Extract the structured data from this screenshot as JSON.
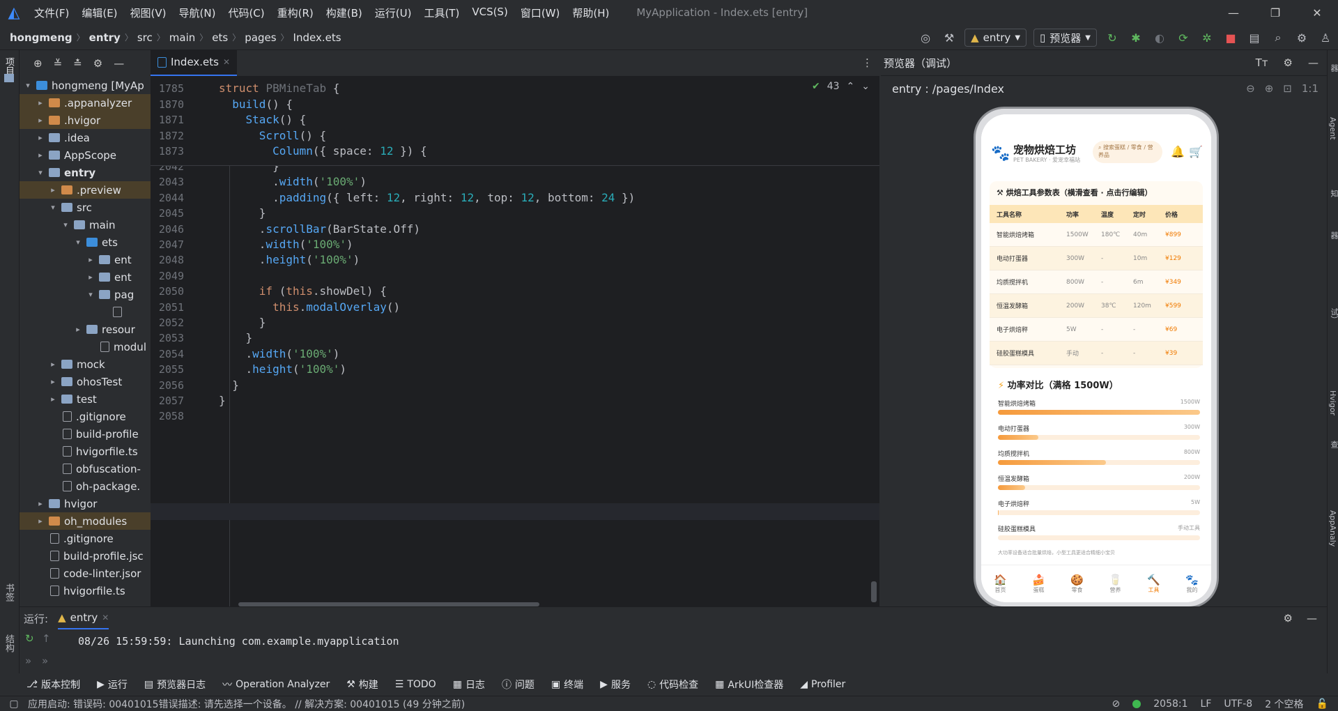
{
  "titlebar": {
    "menus": [
      "文件(F)",
      "编辑(E)",
      "视图(V)",
      "导航(N)",
      "代码(C)",
      "重构(R)",
      "构建(B)",
      "运行(U)",
      "工具(T)",
      "VCS(S)",
      "窗口(W)",
      "帮助(H)"
    ],
    "title": "MyApplication - Index.ets [entry]"
  },
  "breadcrumb": [
    "hongmeng",
    "entry",
    "src",
    "main",
    "ets",
    "pages",
    "Index.ets"
  ],
  "toolbar": {
    "run_config": "entry",
    "device": "预览器"
  },
  "project": {
    "rows": [
      {
        "indent": 0,
        "arrow": "▾",
        "type": "folder-bl",
        "label": "hongmeng [MyAp",
        "hl": ""
      },
      {
        "indent": 1,
        "arrow": "▸",
        "type": "folder-or",
        "label": ".appanalyzer",
        "hl": "hl"
      },
      {
        "indent": 1,
        "arrow": "▸",
        "type": "folder-or",
        "label": ".hvigor",
        "hl": "hl"
      },
      {
        "indent": 1,
        "arrow": "▸",
        "type": "folder",
        "label": ".idea",
        "hl": ""
      },
      {
        "indent": 1,
        "arrow": "▸",
        "type": "folder",
        "label": "AppScope",
        "hl": ""
      },
      {
        "indent": 1,
        "arrow": "▾",
        "type": "folder",
        "label": "entry",
        "hl": "",
        "bold": true
      },
      {
        "indent": 2,
        "arrow": "▸",
        "type": "folder-or",
        "label": ".preview",
        "hl": "hl"
      },
      {
        "indent": 2,
        "arrow": "▾",
        "type": "folder",
        "label": "src",
        "hl": ""
      },
      {
        "indent": 3,
        "arrow": "▾",
        "type": "folder",
        "label": "main",
        "hl": ""
      },
      {
        "indent": 4,
        "arrow": "▾",
        "type": "folder-bl",
        "label": "ets",
        "hl": ""
      },
      {
        "indent": 5,
        "arrow": "▸",
        "type": "folder",
        "label": "ent",
        "hl": ""
      },
      {
        "indent": 5,
        "arrow": "▸",
        "type": "folder",
        "label": "ent",
        "hl": ""
      },
      {
        "indent": 5,
        "arrow": "▾",
        "type": "folder",
        "label": "pag",
        "hl": ""
      },
      {
        "indent": 6,
        "arrow": "",
        "type": "file",
        "label": "",
        "hl": ""
      },
      {
        "indent": 4,
        "arrow": "▸",
        "type": "folder",
        "label": "resour",
        "hl": ""
      },
      {
        "indent": 5,
        "arrow": "",
        "type": "file",
        "label": "modul",
        "hl": ""
      },
      {
        "indent": 2,
        "arrow": "▸",
        "type": "folder",
        "label": "mock",
        "hl": ""
      },
      {
        "indent": 2,
        "arrow": "▸",
        "type": "folder",
        "label": "ohosTest",
        "hl": ""
      },
      {
        "indent": 2,
        "arrow": "▸",
        "type": "folder",
        "label": "test",
        "hl": ""
      },
      {
        "indent": 2,
        "arrow": "",
        "type": "file",
        "label": ".gitignore",
        "hl": ""
      },
      {
        "indent": 2,
        "arrow": "",
        "type": "file",
        "label": "build-profile",
        "hl": ""
      },
      {
        "indent": 2,
        "arrow": "",
        "type": "file",
        "label": "hvigorfile.ts",
        "hl": ""
      },
      {
        "indent": 2,
        "arrow": "",
        "type": "file",
        "label": "obfuscation-",
        "hl": ""
      },
      {
        "indent": 2,
        "arrow": "",
        "type": "file",
        "label": "oh-package.",
        "hl": ""
      },
      {
        "indent": 1,
        "arrow": "▸",
        "type": "folder",
        "label": "hvigor",
        "hl": ""
      },
      {
        "indent": 1,
        "arrow": "▸",
        "type": "folder-or",
        "label": "oh_modules",
        "hl": "hl"
      },
      {
        "indent": 1,
        "arrow": "",
        "type": "file",
        "label": ".gitignore",
        "hl": ""
      },
      {
        "indent": 1,
        "arrow": "",
        "type": "file",
        "label": "build-profile.jsc",
        "hl": ""
      },
      {
        "indent": 1,
        "arrow": "",
        "type": "file",
        "label": "code-linter.jsor",
        "hl": ""
      },
      {
        "indent": 1,
        "arrow": "",
        "type": "file",
        "label": "hvigorfile.ts",
        "hl": ""
      }
    ]
  },
  "editor": {
    "tab": "Index.ets",
    "warnings": "43",
    "sticky": [
      {
        "ln": "1785",
        "html": "<span class='kw'>struct</span> <span class='cls' style='color:#6f737a'>PBMineTab</span> {"
      },
      {
        "ln": "1870",
        "html": "  <span class='fn'>build</span>() {"
      },
      {
        "ln": "1871",
        "html": "    <span class='fn'>Stack</span>() {"
      },
      {
        "ln": "1872",
        "html": "      <span class='fn'>Scroll</span>() {"
      },
      {
        "ln": "1873",
        "html": "        <span class='fn'>Column</span>({ space: <span class='num'>12</span> }) {"
      }
    ],
    "lines": [
      {
        "ln": "2042",
        "html": "        }"
      },
      {
        "ln": "2043",
        "html": "        .<span class='fn'>width</span>(<span class='str'>'100%'</span>)"
      },
      {
        "ln": "2044",
        "html": "        .<span class='fn'>padding</span>({ left: <span class='num'>12</span>, right: <span class='num'>12</span>, top: <span class='num'>12</span>, bottom: <span class='num'>24</span> })"
      },
      {
        "ln": "2045",
        "html": "      }"
      },
      {
        "ln": "2046",
        "html": "      .<span class='fn'>scrollBar</span>(BarState.Off)"
      },
      {
        "ln": "2047",
        "html": "      .<span class='fn'>width</span>(<span class='str'>'100%'</span>)"
      },
      {
        "ln": "2048",
        "html": "      .<span class='fn'>height</span>(<span class='str'>'100%'</span>)"
      },
      {
        "ln": "2049",
        "html": ""
      },
      {
        "ln": "2050",
        "html": "      <span class='kw'>if</span> (<span class='kw'>this</span>.showDel) {"
      },
      {
        "ln": "2051",
        "html": "        <span class='kw'>this</span>.<span class='fn'>modalOverlay</span>()"
      },
      {
        "ln": "2052",
        "html": "      }"
      },
      {
        "ln": "2053",
        "html": "    }"
      },
      {
        "ln": "2054",
        "html": "    .<span class='fn'>width</span>(<span class='str'>'100%'</span>)"
      },
      {
        "ln": "2055",
        "html": "    .<span class='fn'>height</span>(<span class='str'>'100%'</span>)"
      },
      {
        "ln": "2056",
        "html": "  }"
      },
      {
        "ln": "2057",
        "html": "}"
      },
      {
        "ln": "2058",
        "html": ""
      }
    ]
  },
  "preview": {
    "title": "预览器（调试）",
    "route": "entry : /pages/Index",
    "zoom": "1:1",
    "app": {
      "brand": "宠物烘焙工坊",
      "brand_sub": "PET BAKERY · 爱宠幸福站",
      "search_placeholder": "搜索蛋糕 / 零食 / 营养品",
      "table_title": "烘焙工具参数表（横滑查看 · 点击行编辑）",
      "headers": [
        "工具名称",
        "功率",
        "温度",
        "定时",
        "价格"
      ],
      "rows": [
        [
          "智能烘焙烤箱",
          "1500W",
          "180℃",
          "40m",
          "¥899"
        ],
        [
          "电动打蛋器",
          "300W",
          "-",
          "10m",
          "¥129"
        ],
        [
          "均质搅拌机",
          "800W",
          "-",
          "6m",
          "¥349"
        ],
        [
          "恒温发酵箱",
          "200W",
          "38℃",
          "120m",
          "¥599"
        ],
        [
          "电子烘焙秤",
          "5W",
          "-",
          "-",
          "¥69"
        ],
        [
          "硅胶蛋糕模具",
          "手动",
          "-",
          "-",
          "¥39"
        ]
      ],
      "power_title": "功率对比（满格 1500W）",
      "power_max": 1500,
      "power": [
        {
          "name": "智能烘焙烤箱",
          "label": "1500W",
          "value": 1500
        },
        {
          "name": "电动打蛋器",
          "label": "300W",
          "value": 300
        },
        {
          "name": "均质搅拌机",
          "label": "800W",
          "value": 800
        },
        {
          "name": "恒温发酵箱",
          "label": "200W",
          "value": 200
        },
        {
          "name": "电子烘焙秤",
          "label": "5W",
          "value": 5
        },
        {
          "name": "硅胶蛋糕模具",
          "label": "手动工具",
          "value": 0
        }
      ],
      "note": "大功率设备适合批量烘焙，小型工具更适合精细小宝贝",
      "nav": [
        {
          "icon": "🏠",
          "label": "首页",
          "active": false
        },
        {
          "icon": "🍰",
          "label": "蛋糕",
          "active": false
        },
        {
          "icon": "🍪",
          "label": "零食",
          "active": false
        },
        {
          "icon": "🥛",
          "label": "营养",
          "active": false
        },
        {
          "icon": "🔨",
          "label": "工具",
          "active": true
        },
        {
          "icon": "🐾",
          "label": "我的",
          "active": false
        }
      ]
    }
  },
  "run": {
    "label": "运行:",
    "tab": "entry",
    "log": "08/26 15:59:59: Launching com.example.myapplication"
  },
  "toolstrip": [
    "版本控制",
    "运行",
    "预览器日志",
    "Operation Analyzer",
    "构建",
    "TODO",
    "日志",
    "问题",
    "终端",
    "服务",
    "代码检查",
    "ArkUI检查器",
    "Profiler"
  ],
  "status": {
    "message": "应用启动: 错误码: 00401015错误描述: 请先选择一个设备。 // 解决方案: 00401015 (49 分钟之前)",
    "position": "2058:1",
    "eol": "LF",
    "encoding": "UTF-8",
    "indent": "2 个空格"
  },
  "leftstrip": {
    "project": "项目",
    "bookmarks": "书签",
    "structure": "结构"
  },
  "rightstrip": [
    "预览器",
    "Application Agent",
    "通知",
    "数据库检查器",
    "预览器（调试）",
    "Hvigor",
    "问题检查",
    "AppAnaly"
  ]
}
